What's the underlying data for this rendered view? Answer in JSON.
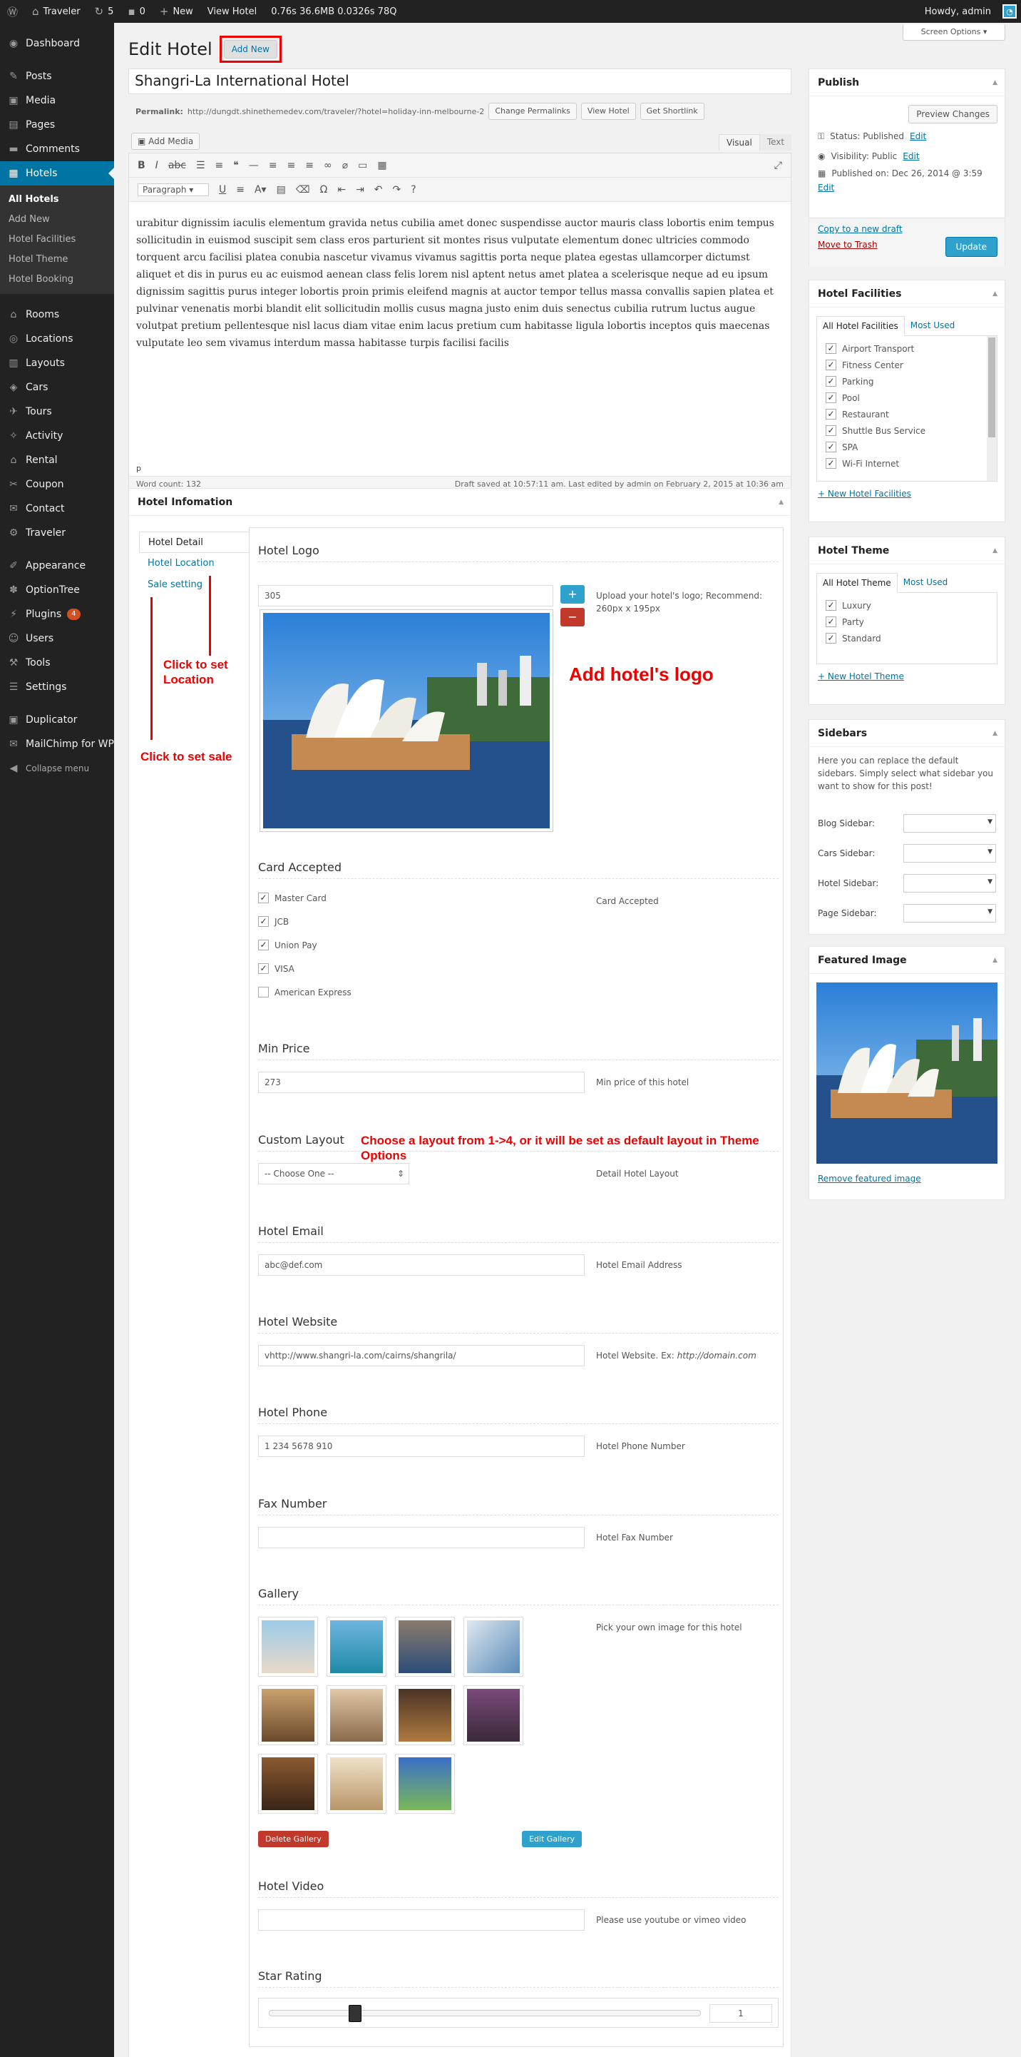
{
  "adminbar": {
    "site": "Traveler",
    "updates": "5",
    "comments": "0",
    "new": "New",
    "view": "View Hotel",
    "stats": "0.76s 36.6MB 0.0326s 78Q",
    "howdy": "Howdy, admin"
  },
  "screen_options": "Screen Options",
  "sidebar": {
    "items": [
      "Dashboard",
      "Posts",
      "Media",
      "Pages",
      "Comments",
      "Hotels"
    ],
    "sub": [
      "All Hotels",
      "Add New",
      "Hotel Facilities",
      "Hotel Theme",
      "Hotel Booking"
    ],
    "items2": [
      "Rooms",
      "Locations",
      "Layouts",
      "Cars",
      "Tours",
      "Activity",
      "Rental",
      "Coupon",
      "Contact",
      "Traveler"
    ],
    "items3": [
      "Appearance",
      "OptionTree",
      "Plugins",
      "Users",
      "Tools",
      "Settings"
    ],
    "plugins_badge": "4",
    "items4": [
      "Duplicator",
      "MailChimp for WP",
      "Collapse menu"
    ]
  },
  "header": {
    "title": "Edit Hotel",
    "add_new": "Add New"
  },
  "post": {
    "title": "Shangri-La International Hotel",
    "permalink_label": "Permalink:",
    "permalink": "http://dungdt.shinethemedev.com/traveler/?hotel=holiday-inn-melbourne-2",
    "change_permalinks": "Change Permalinks",
    "view_hotel": "View Hotel",
    "get_shortlink": "Get Shortlink"
  },
  "editor": {
    "add_media": "Add Media",
    "visual": "Visual",
    "text": "Text",
    "paragraph": "Paragraph",
    "body": "urabitur dignissim iaculis elementum gravida netus cubilia amet donec suspendisse auctor mauris class lobortis enim tempus sollicitudin in euismod suscipit sem class eros parturient sit montes risus vulputate elementum donec ultricies commodo torquent arcu facilisi platea conubia nascetur vivamus vivamus sagittis porta neque platea egestas ullamcorper dictumst aliquet et dis in purus eu ac euismod aenean class felis lorem nisl aptent netus amet platea a scelerisque neque ad eu ipsum dignissim sagittis purus integer lobortis proin primis eleifend magnis at auctor tempor tellus massa convallis sapien platea et pulvinar venenatis morbi blandit elit sollicitudin mollis cusus magna justo enim duis senectus cubilia rutrum luctus augue volutpat pretium pellentesque nisl lacus diam vitae enim lacus pretium cum habitasse ligula lobortis inceptos quis maecenas vulputate leo sem vivamus interdum massa habitasse turpis facilisi facilis",
    "path": "p",
    "word_count": "Word count: 132",
    "draft": "Draft saved at 10:57:11 am. Last edited by admin on February 2, 2015 at 10:36 am"
  },
  "hotel_info": {
    "title": "Hotel Infomation",
    "tabs": [
      "Hotel Detail",
      "Hotel Location",
      "Sale setting"
    ],
    "logo_label": "Hotel Logo",
    "logo_value": "305",
    "logo_desc": "Upload your hotel's logo; Recommend: 260px x 195px",
    "cards_label": "Card Accepted",
    "cards": [
      "Master Card",
      "JCB",
      "Union Pay",
      "VISA",
      "American Express"
    ],
    "cards_desc": "Card Accepted",
    "min_price_label": "Min Price",
    "min_price": "273",
    "min_price_desc": "Min price of this hotel",
    "layout_label": "Custom Layout",
    "layout_value": "-- Choose One --",
    "layout_desc": "Detail Hotel Layout",
    "email_label": "Hotel Email",
    "email": "abc@def.com",
    "email_desc": "Hotel Email Address",
    "website_label": "Hotel Website",
    "website": "vhttp://www.shangri-la.com/cairns/shangrila/",
    "website_desc": "Hotel Website. Ex: ",
    "website_desc_ex": "http://domain.com",
    "phone_label": "Hotel Phone",
    "phone": "1 234 5678 910",
    "phone_desc": "Hotel Phone Number",
    "fax_label": "Fax Number",
    "fax_desc": "Hotel Fax Number",
    "gallery_label": "Gallery",
    "gallery_desc": "Pick your own image for this hotel",
    "delete_gallery": "Delete Gallery",
    "edit_gallery": "Edit Gallery",
    "video_label": "Hotel Video",
    "video_desc": "Please use youtube or vimeo video",
    "star_label": "Star Rating",
    "star_value": "1"
  },
  "annotations": {
    "location": "Click to set Location",
    "sale": "Click to set sale",
    "logo": "Add hotel's logo",
    "layout": "Choose a layout from 1->4, or it will be set as default layout in Theme Options"
  },
  "publish": {
    "title": "Publish",
    "preview": "Preview Changes",
    "status": "Status: Published",
    "visibility": "Visibility: Public",
    "published_on": "Published on: Dec 26, 2014 @ 3:59",
    "edit": "Edit",
    "copy": "Copy to a new draft",
    "trash": "Move to Trash",
    "update": "Update"
  },
  "facilities": {
    "title": "Hotel Facilities",
    "tab_all": "All Hotel Facilities",
    "tab_most": "Most Used",
    "items": [
      "Airport Transport",
      "Fitness Center",
      "Parking",
      "Pool",
      "Restaurant",
      "Shuttle Bus Service",
      "SPA",
      "Wi-Fi Internet"
    ],
    "new": "+ New Hotel Facilities"
  },
  "theme": {
    "title": "Hotel Theme",
    "tab_all": "All Hotel Theme",
    "tab_most": "Most Used",
    "items": [
      "Luxury",
      "Party",
      "Standard"
    ],
    "new": "+ New Hotel Theme"
  },
  "sidebars": {
    "title": "Sidebars",
    "desc": "Here you can replace the default sidebars. Simply select what sidebar you want to show for this post!",
    "fields": [
      "Blog Sidebar:",
      "Cars Sidebar:",
      "Hotel Sidebar:",
      "Page Sidebar:"
    ]
  },
  "featured": {
    "title": "Featured Image",
    "remove": "Remove featured image"
  }
}
